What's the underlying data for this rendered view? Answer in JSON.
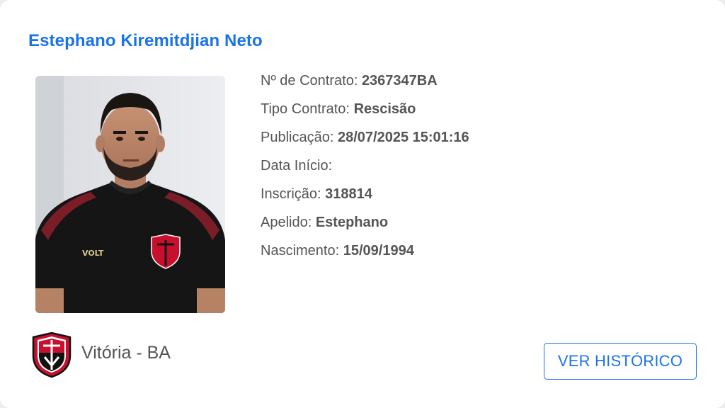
{
  "player": {
    "name": "Estephano Kiremitdjian Neto",
    "photo_icon": "player-photo"
  },
  "details": [
    {
      "label": "Nº de Contrato:",
      "value": "2367347BA"
    },
    {
      "label": "Tipo Contrato:",
      "value": "Rescisão"
    },
    {
      "label": "Publicação:",
      "value": "28/07/2025 15:01:16"
    },
    {
      "label": "Data Início:",
      "value": ""
    },
    {
      "label": "Inscrição:",
      "value": "318814"
    },
    {
      "label": "Apelido:",
      "value": "Estephano"
    },
    {
      "label": "Nascimento:",
      "value": "15/09/1994"
    }
  ],
  "shirt": {
    "brand": "VOLT"
  },
  "club": {
    "name": "Vitória - BA",
    "crest_icon": "club-crest-icon",
    "colors": {
      "red": "#c8102e",
      "black": "#111111"
    }
  },
  "actions": {
    "history_label": "VER HISTÓRICO"
  },
  "colors": {
    "accent": "#1a73e8",
    "text": "#555555"
  }
}
